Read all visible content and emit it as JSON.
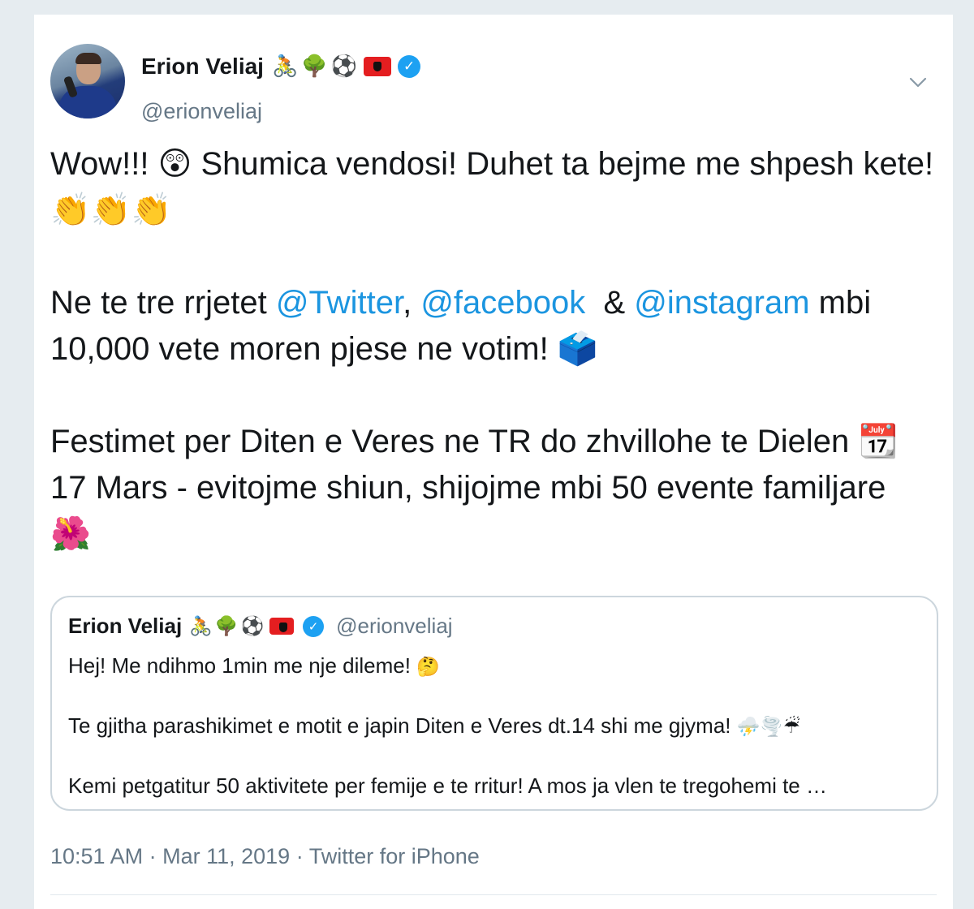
{
  "author": {
    "name": "Erion Veliaj",
    "name_emojis": [
      "🚴",
      "🌳",
      "⚽"
    ],
    "handle": "@erionveliaj",
    "verified_glyph": "✓"
  },
  "icons": {
    "avatar": "avatar-photo",
    "flag": "albania-flag-icon",
    "verified": "verified-badge-icon",
    "menu": "chevron-down-icon"
  },
  "tweet": {
    "line1_pre": "Wow!!! ",
    "line1_emoji": "😲",
    "line1_post": " Shumica vendosi! Duhet ta bejme me shpesh kete! ",
    "line1_claps": "👏👏👏",
    "p2_pre": "Ne te tre rrjetet ",
    "mention_twitter": "@Twitter",
    "p2_comma": ", ",
    "mention_facebook": "@facebook",
    "p2_amp": "  & ",
    "mention_instagram": "@instagram",
    "p2_post": " mbi 10,000 vete moren pjese ne votim! ",
    "p2_emoji": "🗳️",
    "p3_pre": "Festimet per Diten e Veres ne TR do zhvillohe te Dielen ",
    "p3_calendar": "📆",
    "p3_post": " 17 Mars - evitojme shiun, shijojme mbi 50 evente familjare ",
    "p3_flower": "🌺"
  },
  "quoted": {
    "name": "Erion Veliaj",
    "name_emojis": [
      "🚴",
      "🌳",
      "⚽"
    ],
    "handle": "@erionveliaj",
    "line1": "Hej! Me ndihmo 1min me nje dileme! ",
    "line1_emoji": "🤔",
    "line2": "Te gjitha parashikimet e motit e japin Diten e Veres dt.14 shi me gjyma! ",
    "line2_emojis": "⛈️🌪️☔",
    "line3": "Kemi petgatitur 50 aktivitete per femije e te rritur! A mos ja vlen te tregohemi te …"
  },
  "meta": {
    "time": "10:51 AM",
    "sep1": " · ",
    "date": "Mar 11, 2019",
    "sep2": " · ",
    "source": "Twitter for iPhone"
  },
  "colors": {
    "link": "#1b95e0",
    "verified": "#1da1f2",
    "muted": "#657786",
    "border": "#ccd6dd"
  }
}
